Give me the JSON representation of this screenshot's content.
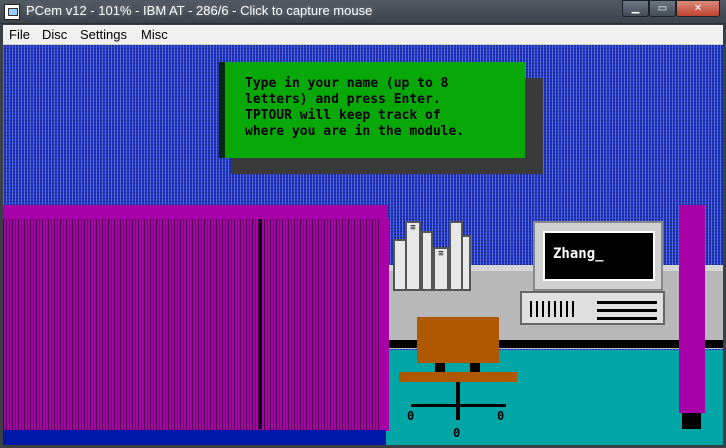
{
  "window": {
    "title": "PCem v12 - 101% - IBM AT - 286/6 - Click to capture mouse",
    "buttons": {
      "minimize": "▁",
      "maximize": "▭",
      "close": "✕"
    }
  },
  "menu": {
    "items": [
      "File",
      "Disc",
      "Settings",
      "Misc"
    ]
  },
  "screen": {
    "dialog_text": "Type in your name (up to 8\nletters) and press Enter.\nTPTOUR will keep track of\nwhere you are in the module.",
    "monitor_input": "Zhang_",
    "book_label_1": "≡",
    "book_label_2": "≡",
    "wheel_glyph": "0"
  },
  "colors": {
    "background": "#1c34c8",
    "dialog": "#08a808",
    "cabinet": "#a800a8",
    "floor": "#00a6a6",
    "chair": "#b05800"
  }
}
